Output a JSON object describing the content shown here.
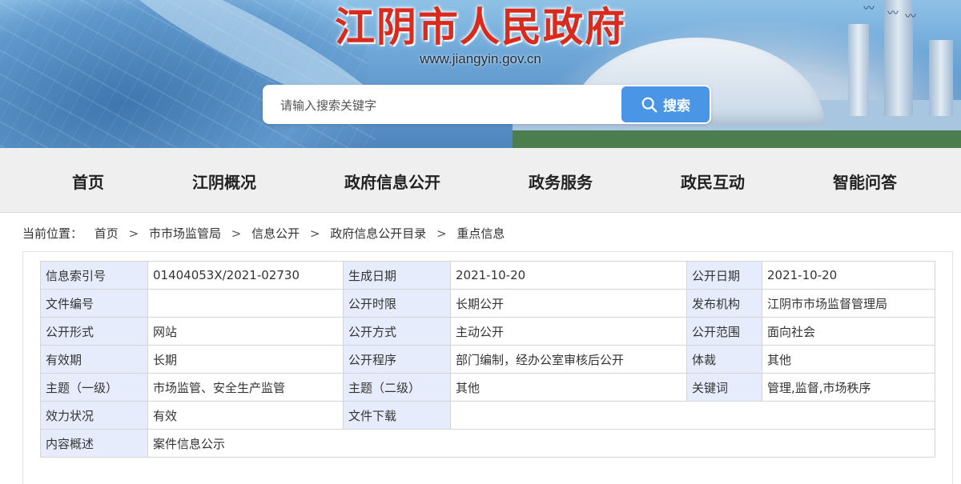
{
  "header": {
    "site_title": "江阴市人民政府",
    "site_url": "www.jiangyin.gov.cn",
    "search": {
      "placeholder": "请输入搜索关键字",
      "button_label": "搜索"
    }
  },
  "nav": {
    "items": [
      {
        "label": "首页"
      },
      {
        "label": "江阴概况"
      },
      {
        "label": "政府信息公开"
      },
      {
        "label": "政务服务"
      },
      {
        "label": "政民互动"
      },
      {
        "label": "智能问答"
      }
    ]
  },
  "breadcrumb": {
    "prefix": "当前位置：",
    "items": [
      "首页",
      "市市场监管局",
      "信息公开",
      "政府信息公开目录",
      "重点信息"
    ],
    "separator": ">"
  },
  "info_table": {
    "rows": [
      [
        {
          "label": "信息索引号",
          "value": "01404053X/2021-02730"
        },
        {
          "label": "生成日期",
          "value": "2021-10-20"
        },
        {
          "label": "公开日期",
          "value": "2021-10-20"
        }
      ],
      [
        {
          "label": "文件编号",
          "value": ""
        },
        {
          "label": "公开时限",
          "value": "长期公开"
        },
        {
          "label": "发布机构",
          "value": "江阴市市场监督管理局"
        }
      ],
      [
        {
          "label": "公开形式",
          "value": "网站"
        },
        {
          "label": "公开方式",
          "value": "主动公开"
        },
        {
          "label": "公开范围",
          "value": "面向社会"
        }
      ],
      [
        {
          "label": "有效期",
          "value": "长期"
        },
        {
          "label": "公开程序",
          "value": "部门编制，经办公室审核后公开"
        },
        {
          "label": "体裁",
          "value": "其他"
        }
      ],
      [
        {
          "label": "主题（一级）",
          "value": "市场监管、安全生产监管"
        },
        {
          "label": "主题（二级）",
          "value": "其他"
        },
        {
          "label": "关键词",
          "value": "管理,监督,市场秩序"
        }
      ]
    ],
    "validity": {
      "label": "效力状况",
      "value": "有效"
    },
    "download": {
      "label": "文件下载",
      "value": ""
    },
    "summary": {
      "label": "内容概述",
      "value": "案件信息公示"
    }
  },
  "colors": {
    "title_red": "#d92a1d",
    "search_button": "#4a95e6",
    "label_cell_bg": "#e6ecfb",
    "nav_bg": "#efefef"
  }
}
